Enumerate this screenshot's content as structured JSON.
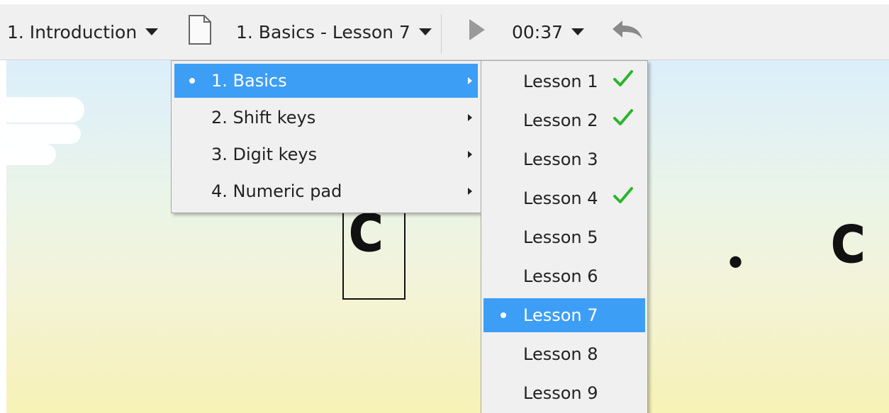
{
  "toolbar": {
    "course_label": "1. Introduction",
    "lesson_label": "1. Basics - Lesson 7",
    "time_label": "00:37",
    "icons": [
      "document-icon",
      "play-icon",
      "undo-icon"
    ]
  },
  "course_menu": {
    "items": [
      {
        "label": "1. Basics",
        "selected": true
      },
      {
        "label": "2. Shift keys",
        "selected": false
      },
      {
        "label": "3. Digit keys",
        "selected": false
      },
      {
        "label": "4. Numeric pad",
        "selected": false
      }
    ]
  },
  "lesson_menu": {
    "items": [
      {
        "label": "Lesson 1",
        "completed": true,
        "selected": false
      },
      {
        "label": "Lesson 2",
        "completed": true,
        "selected": false
      },
      {
        "label": "Lesson 3",
        "completed": false,
        "selected": false
      },
      {
        "label": "Lesson 4",
        "completed": true,
        "selected": false
      },
      {
        "label": "Lesson 5",
        "completed": false,
        "selected": false
      },
      {
        "label": "Lesson 6",
        "completed": false,
        "selected": false
      },
      {
        "label": "Lesson 7",
        "completed": false,
        "selected": true
      },
      {
        "label": "Lesson 8",
        "completed": false,
        "selected": false
      },
      {
        "label": "Lesson 9",
        "completed": false,
        "selected": false
      }
    ]
  },
  "exercise": {
    "current_char": "c",
    "separator": "•",
    "next_char": "c"
  },
  "colors": {
    "selection": "#3d9ef6",
    "check": "#2bb52b",
    "toolbar_bg": "#f0f0f0"
  }
}
